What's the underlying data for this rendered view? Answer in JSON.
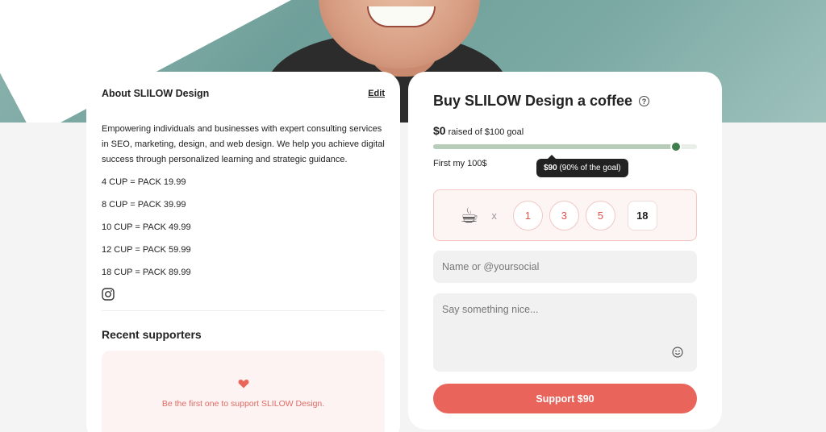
{
  "about": {
    "title": "About SLILOW Design",
    "edit_label": "Edit",
    "description": "Empowering individuals and businesses with expert consulting services in SEO, marketing, design, and web design. We help you achieve digital success through personalized learning and strategic guidance.",
    "packs": [
      "4 CUP = PACK 19.99",
      "8 CUP = PACK 39.99",
      "10 CUP = PACK 49.99",
      "12 CUP = PACK 59.99",
      "18 CUP = PACK 89.99"
    ],
    "social_icon": "instagram-icon"
  },
  "supporters": {
    "title": "Recent supporters",
    "empty_text": "Be the first one to support SLILOW Design.",
    "icon": "heart-icon"
  },
  "coffee": {
    "title": "Buy SLILOW Design a coffee",
    "raised_amount": "$0",
    "raised_text": "raised of $100 goal",
    "progress_fraction": 0.92,
    "goal_label": "First my 100$",
    "tooltip_amount": "$90",
    "tooltip_note": "(90% of the goal)",
    "cup_icon": "☕",
    "times": "x",
    "quantities": [
      "1",
      "3",
      "5"
    ],
    "quantity_value": "18",
    "name_placeholder": "Name or @yoursocial",
    "message_placeholder": "Say something nice...",
    "support_label": "Support $90"
  },
  "colors": {
    "accent": "#e9655c",
    "progress_knob": "#3f7d4c",
    "hero_teal": "#7aa8a2"
  }
}
